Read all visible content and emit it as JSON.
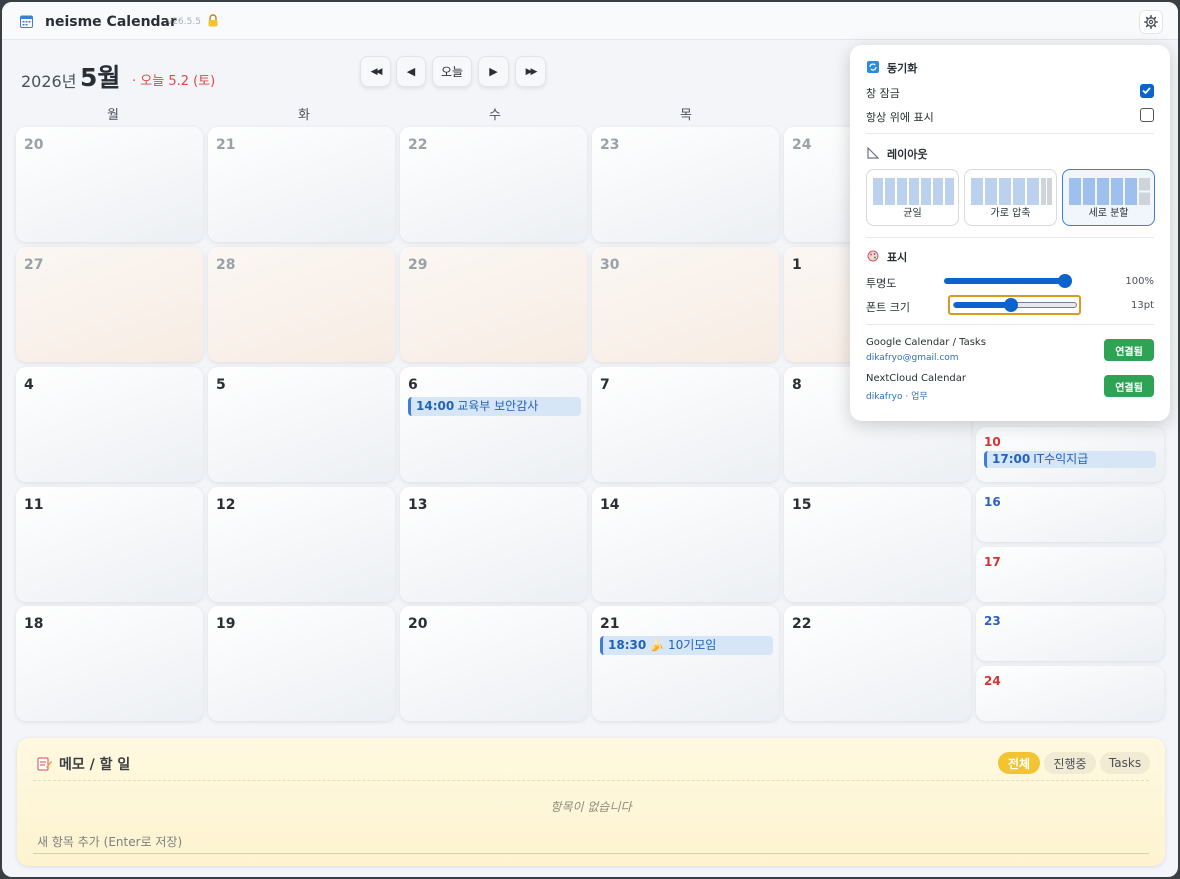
{
  "titlebar": {
    "title": "neisme Calendar",
    "version": "v26.5.5"
  },
  "header": {
    "year": "2026년",
    "month": "5월",
    "today": "· 오늘 5.2 (토)"
  },
  "nav": {
    "prev_prev": "◀◀",
    "prev": "◀",
    "today": "오늘",
    "next": "▶",
    "next_next": "▶▶"
  },
  "weekdays": [
    "월",
    "화",
    "수",
    "목"
  ],
  "weeks": [
    [
      "20",
      "21",
      "22",
      "23",
      "24"
    ],
    [
      "27",
      "28",
      "29",
      "30",
      "1"
    ],
    [
      "4",
      "5",
      "6",
      "7",
      "8"
    ],
    [
      "11",
      "12",
      "13",
      "14",
      "15"
    ],
    [
      "18",
      "19",
      "20",
      "21",
      "22"
    ]
  ],
  "weekend": [
    "10",
    "16",
    "17",
    "23",
    "24"
  ],
  "events": {
    "e1": {
      "time": "14:00",
      "title": "교육부 보안감사"
    },
    "e2": {
      "time": "17:00",
      "title": "IT수익지급"
    },
    "e3": {
      "time": "18:30",
      "title": "🍌 10기모임"
    }
  },
  "memo": {
    "title": "메모 / 할 일",
    "filters": [
      "전체",
      "진행중",
      "Tasks"
    ],
    "empty": "항목이 없습니다",
    "placeholder": "새 항목 추가 (Enter로 저장)"
  },
  "panel": {
    "sync": {
      "title": "동기화",
      "lock_label": "창 잠금",
      "lock_checked": true,
      "top_label": "항상 위에 표시",
      "top_checked": false
    },
    "layout": {
      "title": "레이아웃",
      "options": [
        "균일",
        "가로 압축",
        "세로 분할"
      ],
      "selected": "세로 분할"
    },
    "display": {
      "title": "표시",
      "opacity_label": "투명도",
      "opacity_value": "100%",
      "opacity_fraction": 1.0,
      "font_label": "폰트 크기",
      "font_value": "13pt",
      "font_fraction": 0.45
    },
    "services": [
      {
        "name": "Google Calendar / Tasks",
        "account": "dikafryo@gmail.com",
        "status": "연결됨"
      },
      {
        "name": "NextCloud Calendar",
        "account": "dikafryo · 업무",
        "status": "연결됨"
      }
    ]
  },
  "colors": {
    "accent": "#0b63ce",
    "connected": "#2ea353",
    "today_red": "#e04848",
    "memo_active": "#f2c432"
  }
}
